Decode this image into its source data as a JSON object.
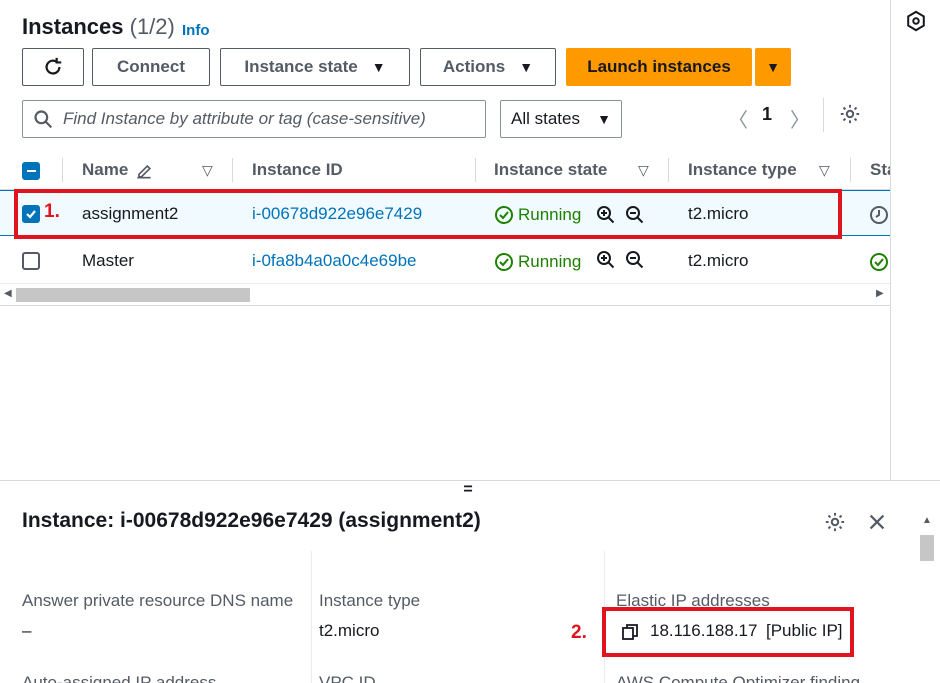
{
  "header": {
    "title": "Instances",
    "count": "(1/2)",
    "info": "Info"
  },
  "toolbar": {
    "connect": "Connect",
    "instance_state": "Instance state",
    "actions": "Actions",
    "launch": "Launch instances"
  },
  "search": {
    "placeholder": "Find Instance by attribute or tag (case-sensitive)"
  },
  "filter": {
    "selected": "All states"
  },
  "pagination": {
    "page": "1"
  },
  "table": {
    "columns": [
      "Name",
      "Instance ID",
      "Instance state",
      "Instance type",
      "Sta"
    ],
    "rows": [
      {
        "name": "assignment2",
        "id": "i-00678d922e96e7429",
        "state": "Running",
        "type": "t2.micro",
        "selected": true
      },
      {
        "name": "Master",
        "id": "i-0fa8b4a0a0c4e69be",
        "state": "Running",
        "type": "t2.micro",
        "selected": false
      }
    ]
  },
  "annotations": {
    "one": "1.",
    "two": "2."
  },
  "details": {
    "title": "Instance: i-00678d922e96e7429 (assignment2)",
    "col1": {
      "label": "Answer private resource DNS name",
      "value": "–",
      "next_label": "Auto-assigned IP address"
    },
    "col2": {
      "label": "Instance type",
      "value": "t2.micro",
      "next_label": "VPC ID"
    },
    "col3": {
      "label": "Elastic IP addresses",
      "ip": "18.116.188.17",
      "ip_suffix": "[Public IP]",
      "next_label": "AWS Compute Optimizer finding"
    }
  },
  "colors": {
    "accent": "#ff9900",
    "link": "#0073bb",
    "success": "#1d8102",
    "annotation": "#e0141e"
  }
}
